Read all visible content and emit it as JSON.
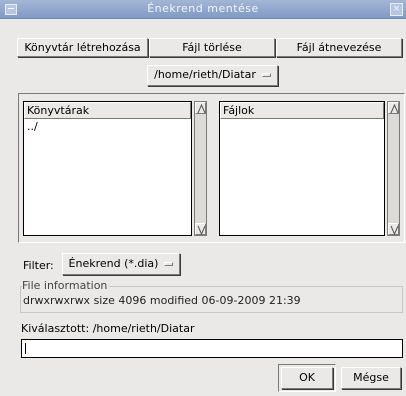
{
  "window": {
    "title": "Énekrend mentése",
    "close_glyph": "×"
  },
  "toolbar": {
    "create_dir_label": "Könyvtár létrehozása",
    "delete_file_label": "Fájl törlése",
    "rename_file_label": "Fájl átnevezése"
  },
  "path_menu": {
    "value": "/home/rieth/Diatar"
  },
  "dirs": {
    "header": "Könyvtárak",
    "items": [
      "../"
    ]
  },
  "files": {
    "header": "Fájlok",
    "items": []
  },
  "filter": {
    "label": "Filter:",
    "value": "Énekrend (*.dia)"
  },
  "file_info": {
    "legend": "File information",
    "text": "drwxrwxrwx  size 4096  modified 06-09-2009 21:39"
  },
  "selection": {
    "label": "Kiválasztott: /home/rieth/Diatar",
    "entry_value": ""
  },
  "buttons": {
    "ok_label": "OK",
    "cancel_label": "Mégse"
  }
}
